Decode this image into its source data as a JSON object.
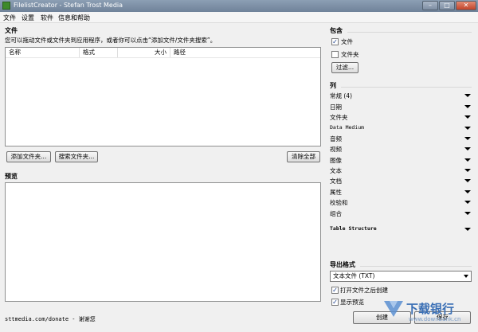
{
  "window": {
    "title": "FilelistCreator - Stefan Trost Media",
    "buttons": {
      "minimize": "–",
      "maximize": "□",
      "close": "✕"
    }
  },
  "menu": [
    "文件",
    "设置",
    "软件",
    "信息和帮助"
  ],
  "files": {
    "heading": "文件",
    "instruction": "您可以拖动文件或文件夹到应用程序，或者你可以点击“添加文件/文件夹搜索”。",
    "columns": [
      "名称",
      "格式",
      "大小",
      "路径"
    ],
    "add_files_button": "添加文件夹...",
    "search_folder_button": "搜索文件夹...",
    "clear_all_button": "清除全部"
  },
  "preview": {
    "heading": "预览"
  },
  "footer": {
    "donate": "sttmedia.com/donate - 谢谢您"
  },
  "include": {
    "heading": "包含",
    "files_label": "文件",
    "files_checked": true,
    "folders_label": "文件夹",
    "folders_checked": false,
    "filter_button": "过滤..."
  },
  "columns_panel": {
    "heading": "列",
    "items": [
      "常规 (4)",
      "日期",
      "文件夹",
      "Data Medium",
      "音频",
      "视频",
      "图像",
      "文本",
      "文档",
      "属性",
      "校验和",
      "组合"
    ],
    "table_structure": "Table Structure"
  },
  "export": {
    "heading": "导出格式",
    "format_value": "文本文件 (TXT)",
    "open_after_label": "打开文件之后创建",
    "open_after_checked": true,
    "show_preview_label": "显示预览",
    "show_preview_checked": true,
    "create_button": "创建",
    "save_button": "保存"
  },
  "watermark": {
    "text": "下载银行",
    "url": "www.downbank.cn"
  },
  "colors": {
    "titlebar": "#7f92a8",
    "panel_border": "#8e8f8f",
    "watermark": "#3a6fb5"
  }
}
